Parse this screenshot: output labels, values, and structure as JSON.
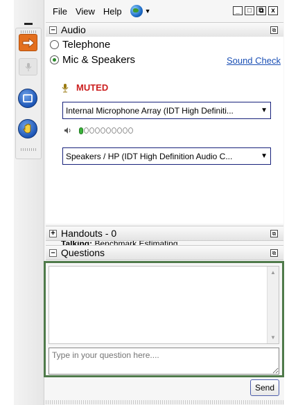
{
  "menu": {
    "file": "File",
    "view": "View",
    "help": "Help"
  },
  "window_controls": {
    "minimize": "_",
    "restore": "□",
    "popout": "⧉",
    "close": "x"
  },
  "audio": {
    "title": "Audio",
    "options": [
      {
        "label": "Telephone",
        "selected": false
      },
      {
        "label": "Mic & Speakers",
        "selected": true
      }
    ],
    "sound_check": "Sound Check",
    "status": "MUTED",
    "microphone": "Internal Microphone Array (IDT High Definiti...",
    "speakers": "Speakers / HP (IDT High Definition Audio C...",
    "speaker_level": 0.1,
    "talking_label": "Talking:",
    "talking_value": "Benchmark Estimating"
  },
  "handouts": {
    "title": "Handouts - 0"
  },
  "questions": {
    "title": "Questions",
    "input_placeholder": "Type in your question here....",
    "send": "Send"
  },
  "colors": {
    "accent": "#e36f1e",
    "muted": "#cc1f1f",
    "link": "#1a4fb5",
    "highlight_border": "#4f7a4a"
  },
  "icons": [
    "minimize-icon",
    "arrow-right-icon",
    "microphone-icon",
    "screen-icon",
    "raise-hand-icon",
    "globe-icon",
    "speaker-icon"
  ]
}
